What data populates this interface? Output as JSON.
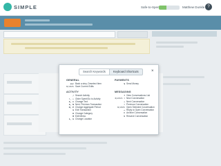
{
  "header": {
    "brand": "SIMPLE",
    "safe_to_spend_label": "Safe-to-Spend",
    "safe_to_spend_level": 0.35,
    "user_menu_label": "Matthew Dunkle",
    "help_label": "?"
  },
  "colors": {
    "brand": "#34b7a7",
    "banner": "#5a8ea9",
    "badge": "#e9822d",
    "alert_bg": "#f4f0d8"
  },
  "dialog": {
    "tabs": [
      {
        "label": "Search Keywords",
        "active": false
      },
      {
        "label": "Keyboard Shortcuts",
        "active": true
      }
    ],
    "close_label": "×",
    "sections": {
      "general": {
        "title": "GENERAL",
        "rows": [
          {
            "key": "esc",
            "desc": "Back a step, Deselect Item"
          },
          {
            "key": "⌘/ctrl",
            "desc": "Save Current Edits"
          }
        ]
      },
      "activity": {
        "title": "ACTIVITY",
        "rows": [
          {
            "key": "/",
            "desc": "Search Activity"
          },
          {
            "key": "↑, ↓",
            "desc": "Older Spent/Go to Activity"
          },
          {
            "key": "A, C",
            "desc": "Change Text"
          },
          {
            "key": "G, N",
            "desc": "Next, Previous Transaction"
          },
          {
            "key": "N, P",
            "desc": "Change Aggregate Period"
          },
          {
            "key": "G",
            "desc": "Edit Transaction"
          },
          {
            "key": "K",
            "desc": "Change Category"
          },
          {
            "key": "M",
            "desc": "Edit Memo"
          },
          {
            "key": "L, G",
            "desc": "Change Location"
          }
        ]
      },
      "payments": {
        "title": "PAYMENTS",
        "rows": [
          {
            "key": "$",
            "desc": "Send Money"
          }
        ]
      },
      "messaging": {
        "title": "MESSAGING",
        "rows": [
          {
            "key": "?",
            "desc": "View Conversations List"
          },
          {
            "key": "⌘/ctrl ↑",
            "desc": "New Conversation"
          },
          {
            "key": "↓",
            "desc": "Next Conversation"
          },
          {
            "key": "↑",
            "desc": "Previous Conversation"
          },
          {
            "key": "⌘/ctrl",
            "desc": "Open Selected Conversation"
          },
          {
            "key": "↵",
            "desc": "Reply to Open Conversation"
          },
          {
            "key": "C",
            "desc": "Archive Conversation"
          },
          {
            "key": "V",
            "desc": "Resolve Conversation"
          }
        ]
      }
    }
  }
}
